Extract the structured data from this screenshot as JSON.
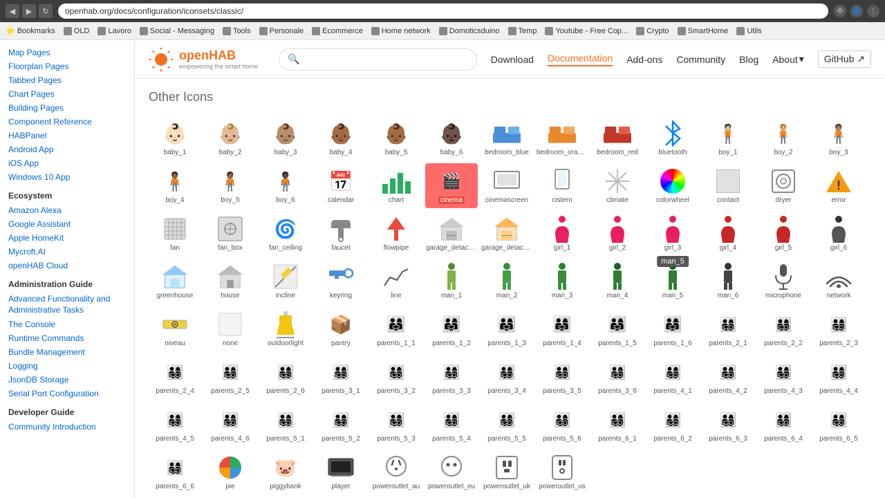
{
  "browser": {
    "url": "openhab.org/docs/configuration/iconsets/classic/",
    "bookmarks": [
      "Bookmarks",
      "OLD",
      "Lavoro",
      "Social - Messaging",
      "Tools",
      "Personale",
      "Ecommerce",
      "Home network",
      "Domoticsduino",
      "Temp",
      "Youtube - Free Cop...",
      "Crypto",
      "SmartHome",
      "Utils"
    ]
  },
  "topnav": {
    "logo_text": "openHAB",
    "search_placeholder": "",
    "links": [
      "Download",
      "Documentation",
      "Add-ons",
      "Community",
      "Blog",
      "About",
      "GitHub"
    ]
  },
  "sidebar": {
    "sections": [
      {
        "title": "",
        "items": [
          "Map Pages",
          "Floorplan Pages",
          "Tabbed Pages",
          "Chart Pages",
          "Building Pages",
          "Component Reference",
          "HABPanel",
          "Android App",
          "iOS App",
          "Windows 10 App"
        ]
      },
      {
        "title": "Ecosystem",
        "items": [
          "Amazon Alexa",
          "Google Assistant",
          "Apple HomeKit",
          "Mycroft.AI",
          "openHAB Cloud"
        ]
      },
      {
        "title": "Administration Guide",
        "items": [
          "Advanced Functionality and Administrative Tasks",
          "The Console",
          "Runtime Commands",
          "Bundle Management",
          "Logging",
          "JsonDB Storage",
          "Serial Port Configuration"
        ]
      },
      {
        "title": "Developer Guide",
        "items": [
          "Community Introduction"
        ]
      }
    ]
  },
  "content": {
    "section_title": "Other Icons",
    "icons": [
      {
        "id": "baby_1",
        "label": "baby_1",
        "emoji": "👶",
        "skin": "light"
      },
      {
        "id": "baby_2",
        "label": "baby_2",
        "emoji": "👶",
        "skin": "medium-light"
      },
      {
        "id": "baby_3",
        "label": "baby_3",
        "emoji": "👶",
        "skin": "medium"
      },
      {
        "id": "baby_4",
        "label": "baby_4",
        "emoji": "👶",
        "skin": "medium-dark"
      },
      {
        "id": "baby_5",
        "label": "baby_5",
        "emoji": "👶",
        "skin": "dark"
      },
      {
        "id": "baby_6",
        "label": "baby_6",
        "emoji": "👶🏿",
        "skin": "darkest"
      },
      {
        "id": "bedroom_blue",
        "label": "bedroom_blue",
        "type": "bed",
        "color": "#4a90d9"
      },
      {
        "id": "bedroom_orange",
        "label": "bedroom_orange",
        "type": "bed",
        "color": "#e8892b"
      },
      {
        "id": "bedroom_red",
        "label": "bedroom_red",
        "type": "bed",
        "color": "#c0392b"
      },
      {
        "id": "bluetooth",
        "label": "bluetooth",
        "type": "bluetooth"
      },
      {
        "id": "boy_1",
        "label": "boy_1",
        "emoji": "🧍",
        "tint": "light"
      },
      {
        "id": "boy_2",
        "label": "boy_2",
        "emoji": "🧍",
        "tint": "medium-light"
      },
      {
        "id": "boy_3",
        "label": "boy_3",
        "emoji": "🧍",
        "tint": "medium"
      },
      {
        "id": "boy_4",
        "label": "boy_4",
        "emoji": "🧍",
        "tint": "medium-dark"
      },
      {
        "id": "boy_5",
        "label": "boy_5",
        "emoji": "🧍",
        "tint": "dark"
      },
      {
        "id": "boy_6",
        "label": "boy_6",
        "emoji": "🧍🏿",
        "tint": "darkest"
      },
      {
        "id": "calendar",
        "label": "calendar",
        "emoji": "📅"
      },
      {
        "id": "chart",
        "label": "chart",
        "type": "chart"
      },
      {
        "id": "cinema",
        "label": "cinema",
        "type": "cinema",
        "highlighted": true
      },
      {
        "id": "cinemascreen",
        "label": "cinemascreen",
        "emoji": "🖥"
      },
      {
        "id": "cistern",
        "label": "cistern",
        "emoji": "🚽"
      },
      {
        "id": "climate",
        "label": "climate",
        "emoji": "❄"
      },
      {
        "id": "colorwheel",
        "label": "colorwheel",
        "type": "colorwheel"
      },
      {
        "id": "contact",
        "label": "contact",
        "type": "contact"
      },
      {
        "id": "dryer",
        "label": "dryer",
        "type": "dryer"
      },
      {
        "id": "error",
        "label": "error",
        "type": "warning"
      },
      {
        "id": "fan",
        "label": "fan",
        "type": "fan"
      },
      {
        "id": "fan_box",
        "label": "fan_box",
        "type": "fan_box"
      },
      {
        "id": "fan_ceiling",
        "label": "fan_ceiling",
        "emoji": "🌀"
      },
      {
        "id": "faucet",
        "label": "faucet",
        "emoji": "🚿"
      },
      {
        "id": "flowpipe",
        "label": "flowpipe",
        "emoji": "⬆"
      },
      {
        "id": "garage_detached",
        "label": "garage_detached",
        "emoji": "🏠"
      },
      {
        "id": "garage_detached_selected",
        "label": "garage_detached_selected",
        "emoji": "🏡"
      },
      {
        "id": "girl_1",
        "label": "girl_1",
        "emoji": "👧",
        "skin": "red"
      },
      {
        "id": "girl_2",
        "label": "girl_2",
        "emoji": "👧",
        "skin": "red"
      },
      {
        "id": "girl_3",
        "label": "girl_3",
        "emoji": "👧",
        "skin": "red"
      },
      {
        "id": "girl_4",
        "label": "girl_4",
        "emoji": "👧",
        "skin": "dark-red"
      },
      {
        "id": "girl_5",
        "label": "girl_5",
        "emoji": "👧",
        "skin": "dark-red"
      },
      {
        "id": "girl_6",
        "label": "girl_6",
        "emoji": "👧",
        "skin": "darkest"
      },
      {
        "id": "greenhouse",
        "label": "greenhouse",
        "emoji": "🏠"
      },
      {
        "id": "house",
        "label": "house",
        "emoji": "🏠"
      },
      {
        "id": "incline",
        "label": "incline",
        "emoji": "📐"
      },
      {
        "id": "keyring",
        "label": "keyring",
        "emoji": "🗝"
      },
      {
        "id": "line",
        "label": "line",
        "emoji": "📈"
      },
      {
        "id": "man_1",
        "label": "man_1",
        "emoji": "🧍",
        "tint": "green-light"
      },
      {
        "id": "man_2",
        "label": "man_2",
        "emoji": "🧍",
        "tint": "green"
      },
      {
        "id": "man_3",
        "label": "man_3",
        "emoji": "🧍",
        "tint": "green"
      },
      {
        "id": "man_4",
        "label": "man_4",
        "emoji": "🧍",
        "tint": "green"
      },
      {
        "id": "man_5",
        "label": "man_5",
        "emoji": "🧍",
        "tint": "green",
        "tooltip": "man_5"
      },
      {
        "id": "man_6",
        "label": "man_6",
        "emoji": "🧍",
        "tint": "dark"
      },
      {
        "id": "microphone",
        "label": "microphone",
        "emoji": "🎤"
      },
      {
        "id": "network",
        "label": "network",
        "type": "network"
      },
      {
        "id": "niveau",
        "label": "niveau",
        "emoji": "📏"
      },
      {
        "id": "none",
        "label": "none",
        "emoji": "⬜"
      },
      {
        "id": "outdoorlight",
        "label": "outdoorlight",
        "type": "outdoor"
      },
      {
        "id": "pantry",
        "label": "pantry",
        "emoji": "📦"
      },
      {
        "id": "parents_1_1",
        "label": "parents_1_1",
        "emoji": "👨‍👩‍👧"
      },
      {
        "id": "parents_1_2",
        "label": "parents_1_2",
        "emoji": "👨‍👩‍👧"
      },
      {
        "id": "parents_1_3",
        "label": "parents_1_3",
        "emoji": "👨‍👩‍👧"
      },
      {
        "id": "parents_1_4",
        "label": "parents_1_4",
        "emoji": "👨‍👩‍👧"
      },
      {
        "id": "parents_1_5",
        "label": "parents_1_5",
        "emoji": "👨‍👩‍👧"
      },
      {
        "id": "parents_1_6",
        "label": "parents_1_6",
        "emoji": "👨‍👩‍👧"
      },
      {
        "id": "parents_2_1",
        "label": "parents_2_1",
        "emoji": "👨‍👩‍👧‍👦"
      },
      {
        "id": "parents_2_2",
        "label": "parents_2_2",
        "emoji": "👨‍👩‍👧‍👦"
      },
      {
        "id": "parents_2_3",
        "label": "parents_2_3",
        "emoji": "👨‍👩‍👧‍👦"
      },
      {
        "id": "parents_2_4",
        "label": "parents_2_4",
        "emoji": "👨‍👩‍👧‍👦"
      },
      {
        "id": "parents_2_5",
        "label": "parents_2_5",
        "emoji": "👨‍👩‍👧‍👦"
      },
      {
        "id": "parents_2_6",
        "label": "parents_2_6",
        "emoji": "👨‍👩‍👧‍👦"
      },
      {
        "id": "parents_3_1",
        "label": "parents_3_1",
        "emoji": "👨‍👩‍👧‍👦"
      },
      {
        "id": "parents_3_2",
        "label": "parents_3_2",
        "emoji": "👨‍👩‍👧‍👦"
      },
      {
        "id": "parents_3_3",
        "label": "parents_3_3",
        "emoji": "👨‍👩‍👧‍👦"
      },
      {
        "id": "parents_3_4",
        "label": "parents_3_4",
        "emoji": "👨‍👩‍👧‍👦"
      },
      {
        "id": "parents_3_5",
        "label": "parents_3_5",
        "emoji": "👨‍👩‍👧‍👦"
      },
      {
        "id": "parents_3_6",
        "label": "parents_3_6",
        "emoji": "👨‍👩‍👧‍👦"
      },
      {
        "id": "parents_4_1",
        "label": "parents_4_1",
        "emoji": "👨‍👩‍👧‍👦"
      },
      {
        "id": "parents_4_2",
        "label": "parents_4_2",
        "emoji": "👨‍👩‍👧‍👦"
      },
      {
        "id": "parents_4_3",
        "label": "parents_4_3",
        "emoji": "👨‍👩‍👧‍👦"
      },
      {
        "id": "parents_4_4",
        "label": "parents_4_4",
        "emoji": "👨‍👩‍👧‍👦"
      },
      {
        "id": "parents_4_5",
        "label": "parents_4_5",
        "emoji": "👨‍👩‍👧‍👦"
      },
      {
        "id": "parents_4_6",
        "label": "parents_4_6",
        "emoji": "👨‍👩‍👧‍👦"
      },
      {
        "id": "parents_5_1",
        "label": "parents_5_1",
        "emoji": "👨‍👩‍👧‍👦"
      },
      {
        "id": "parents_5_2",
        "label": "parents_5_2",
        "emoji": "👨‍👩‍👧‍👦"
      },
      {
        "id": "parents_5_3",
        "label": "parents_5_3",
        "emoji": "👨‍👩‍👧‍👦"
      },
      {
        "id": "parents_5_4",
        "label": "parents_5_4",
        "emoji": "👨‍👩‍👧‍👦"
      },
      {
        "id": "parents_5_5",
        "label": "parents_5_5",
        "emoji": "👨‍👩‍👧‍👦"
      },
      {
        "id": "parents_5_6",
        "label": "parents_5_6",
        "emoji": "👨‍👩‍👧‍👦"
      },
      {
        "id": "parents_6_1",
        "label": "parents_6_1",
        "emoji": "👨‍👩‍👧‍👦"
      },
      {
        "id": "parents_6_2",
        "label": "parents_6_2",
        "emoji": "👨‍👩‍👧‍👦"
      },
      {
        "id": "parents_6_3",
        "label": "parents_6_3",
        "emoji": "👨‍👩‍👧‍👦"
      },
      {
        "id": "parents_6_4",
        "label": "parents_6_4",
        "emoji": "👨‍👩‍👧‍👦"
      },
      {
        "id": "parents_6_5",
        "label": "parents_6_5",
        "emoji": "👨‍👩‍👧‍👦"
      },
      {
        "id": "parents_6_6",
        "label": "parents_6_6",
        "emoji": "👨‍👩‍👧‍👦"
      },
      {
        "id": "pie",
        "label": "pie",
        "type": "pie"
      },
      {
        "id": "piggybank",
        "label": "piggybank",
        "emoji": "🐷"
      },
      {
        "id": "player",
        "label": "player",
        "emoji": "📺"
      },
      {
        "id": "poweroutlet_au",
        "label": "poweroutlet_au",
        "type": "outlet"
      },
      {
        "id": "poweroutlet_eu",
        "label": "poweroutlet_eu",
        "type": "outlet_eu"
      },
      {
        "id": "poweroutlet_uk",
        "label": "poweroutlet_uk",
        "type": "outlet_uk"
      },
      {
        "id": "poweroutlet_us",
        "label": "poweroutlet_us",
        "type": "outlet_us"
      }
    ]
  }
}
